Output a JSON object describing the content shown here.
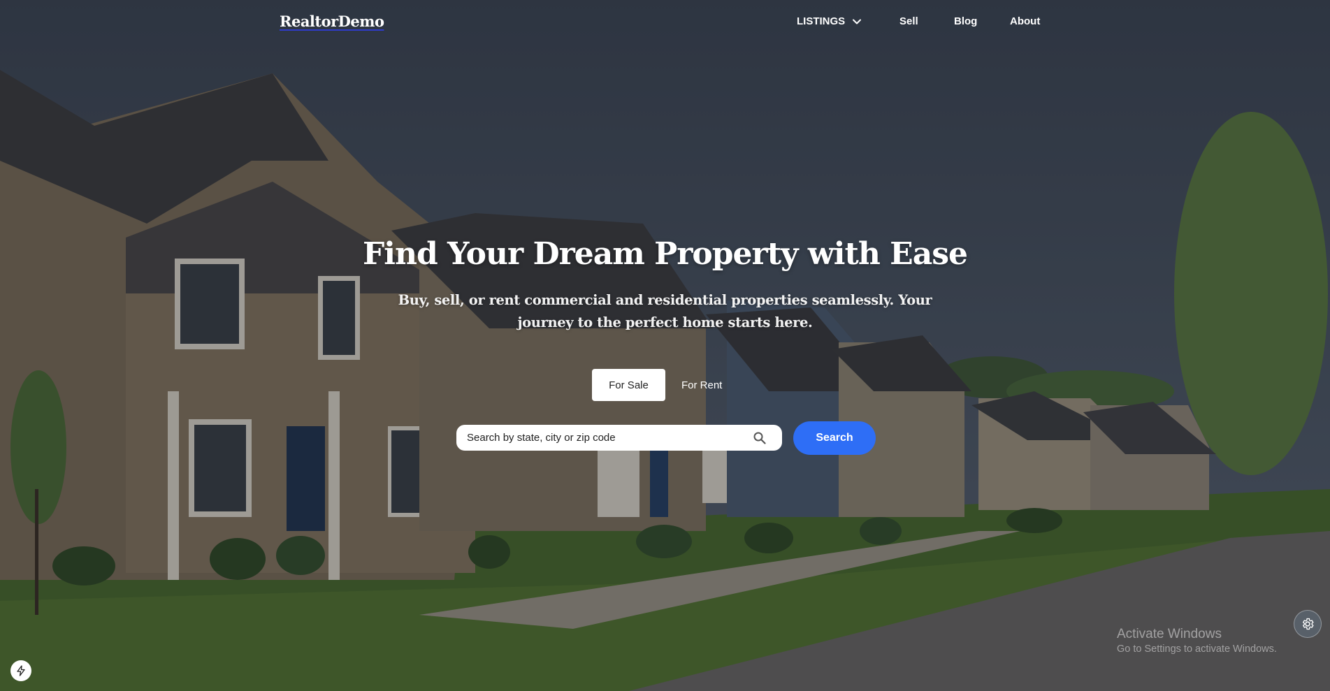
{
  "nav": {
    "logo": "RealtorDemo",
    "listings": "LISTINGS",
    "sell": "Sell",
    "blog": "Blog",
    "about": "About"
  },
  "hero": {
    "title": "Find Your Dream Property with Ease",
    "subtitle": "Buy, sell, or rent commercial and residential properties seamlessly. Your journey to the perfect home starts here.",
    "tabs": [
      "For Sale",
      "For Rent"
    ],
    "active_tab": "For Sale"
  },
  "search": {
    "placeholder": "Search by state, city or zip code",
    "button": "Search"
  },
  "watermark": {
    "line1": "Activate Windows",
    "line2": "Go to Settings to activate Windows."
  },
  "colors": {
    "accent": "#2e6ef6",
    "logo_underline": "#2f3cc9"
  },
  "icons": {
    "listings_chevron": "chevron-down-icon",
    "search": "search-icon",
    "settings": "gear-icon",
    "bolt": "bolt-icon"
  }
}
